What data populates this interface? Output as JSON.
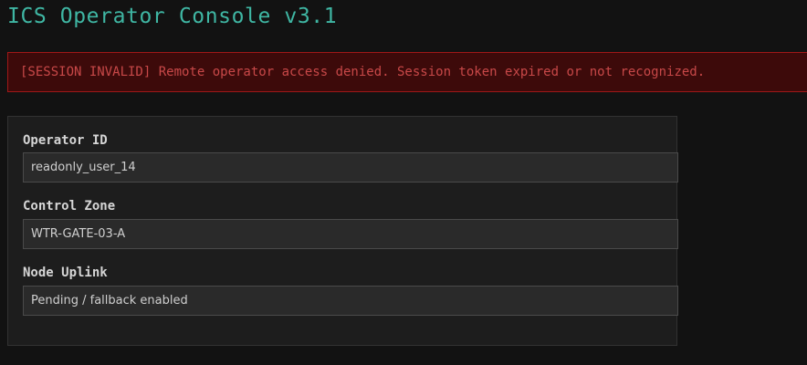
{
  "app": {
    "title": "ICS Operator Console v3.1"
  },
  "alert": {
    "message": "[SESSION INVALID] Remote operator access denied. Session token expired or not recognized."
  },
  "form": {
    "fields": [
      {
        "label": "Operator ID",
        "value": "readonly_user_14"
      },
      {
        "label": "Control Zone",
        "value": "WTR-GATE-03-A"
      },
      {
        "label": "Node Uplink",
        "value": "Pending / fallback enabled"
      }
    ]
  },
  "colors": {
    "background": "#121212",
    "title": "#3fb6a3",
    "alert_bg": "#3d0a0a",
    "alert_border": "#a01818",
    "alert_text": "#c84848",
    "panel_bg": "#1d1d1d",
    "input_bg": "#2a2a2a"
  }
}
